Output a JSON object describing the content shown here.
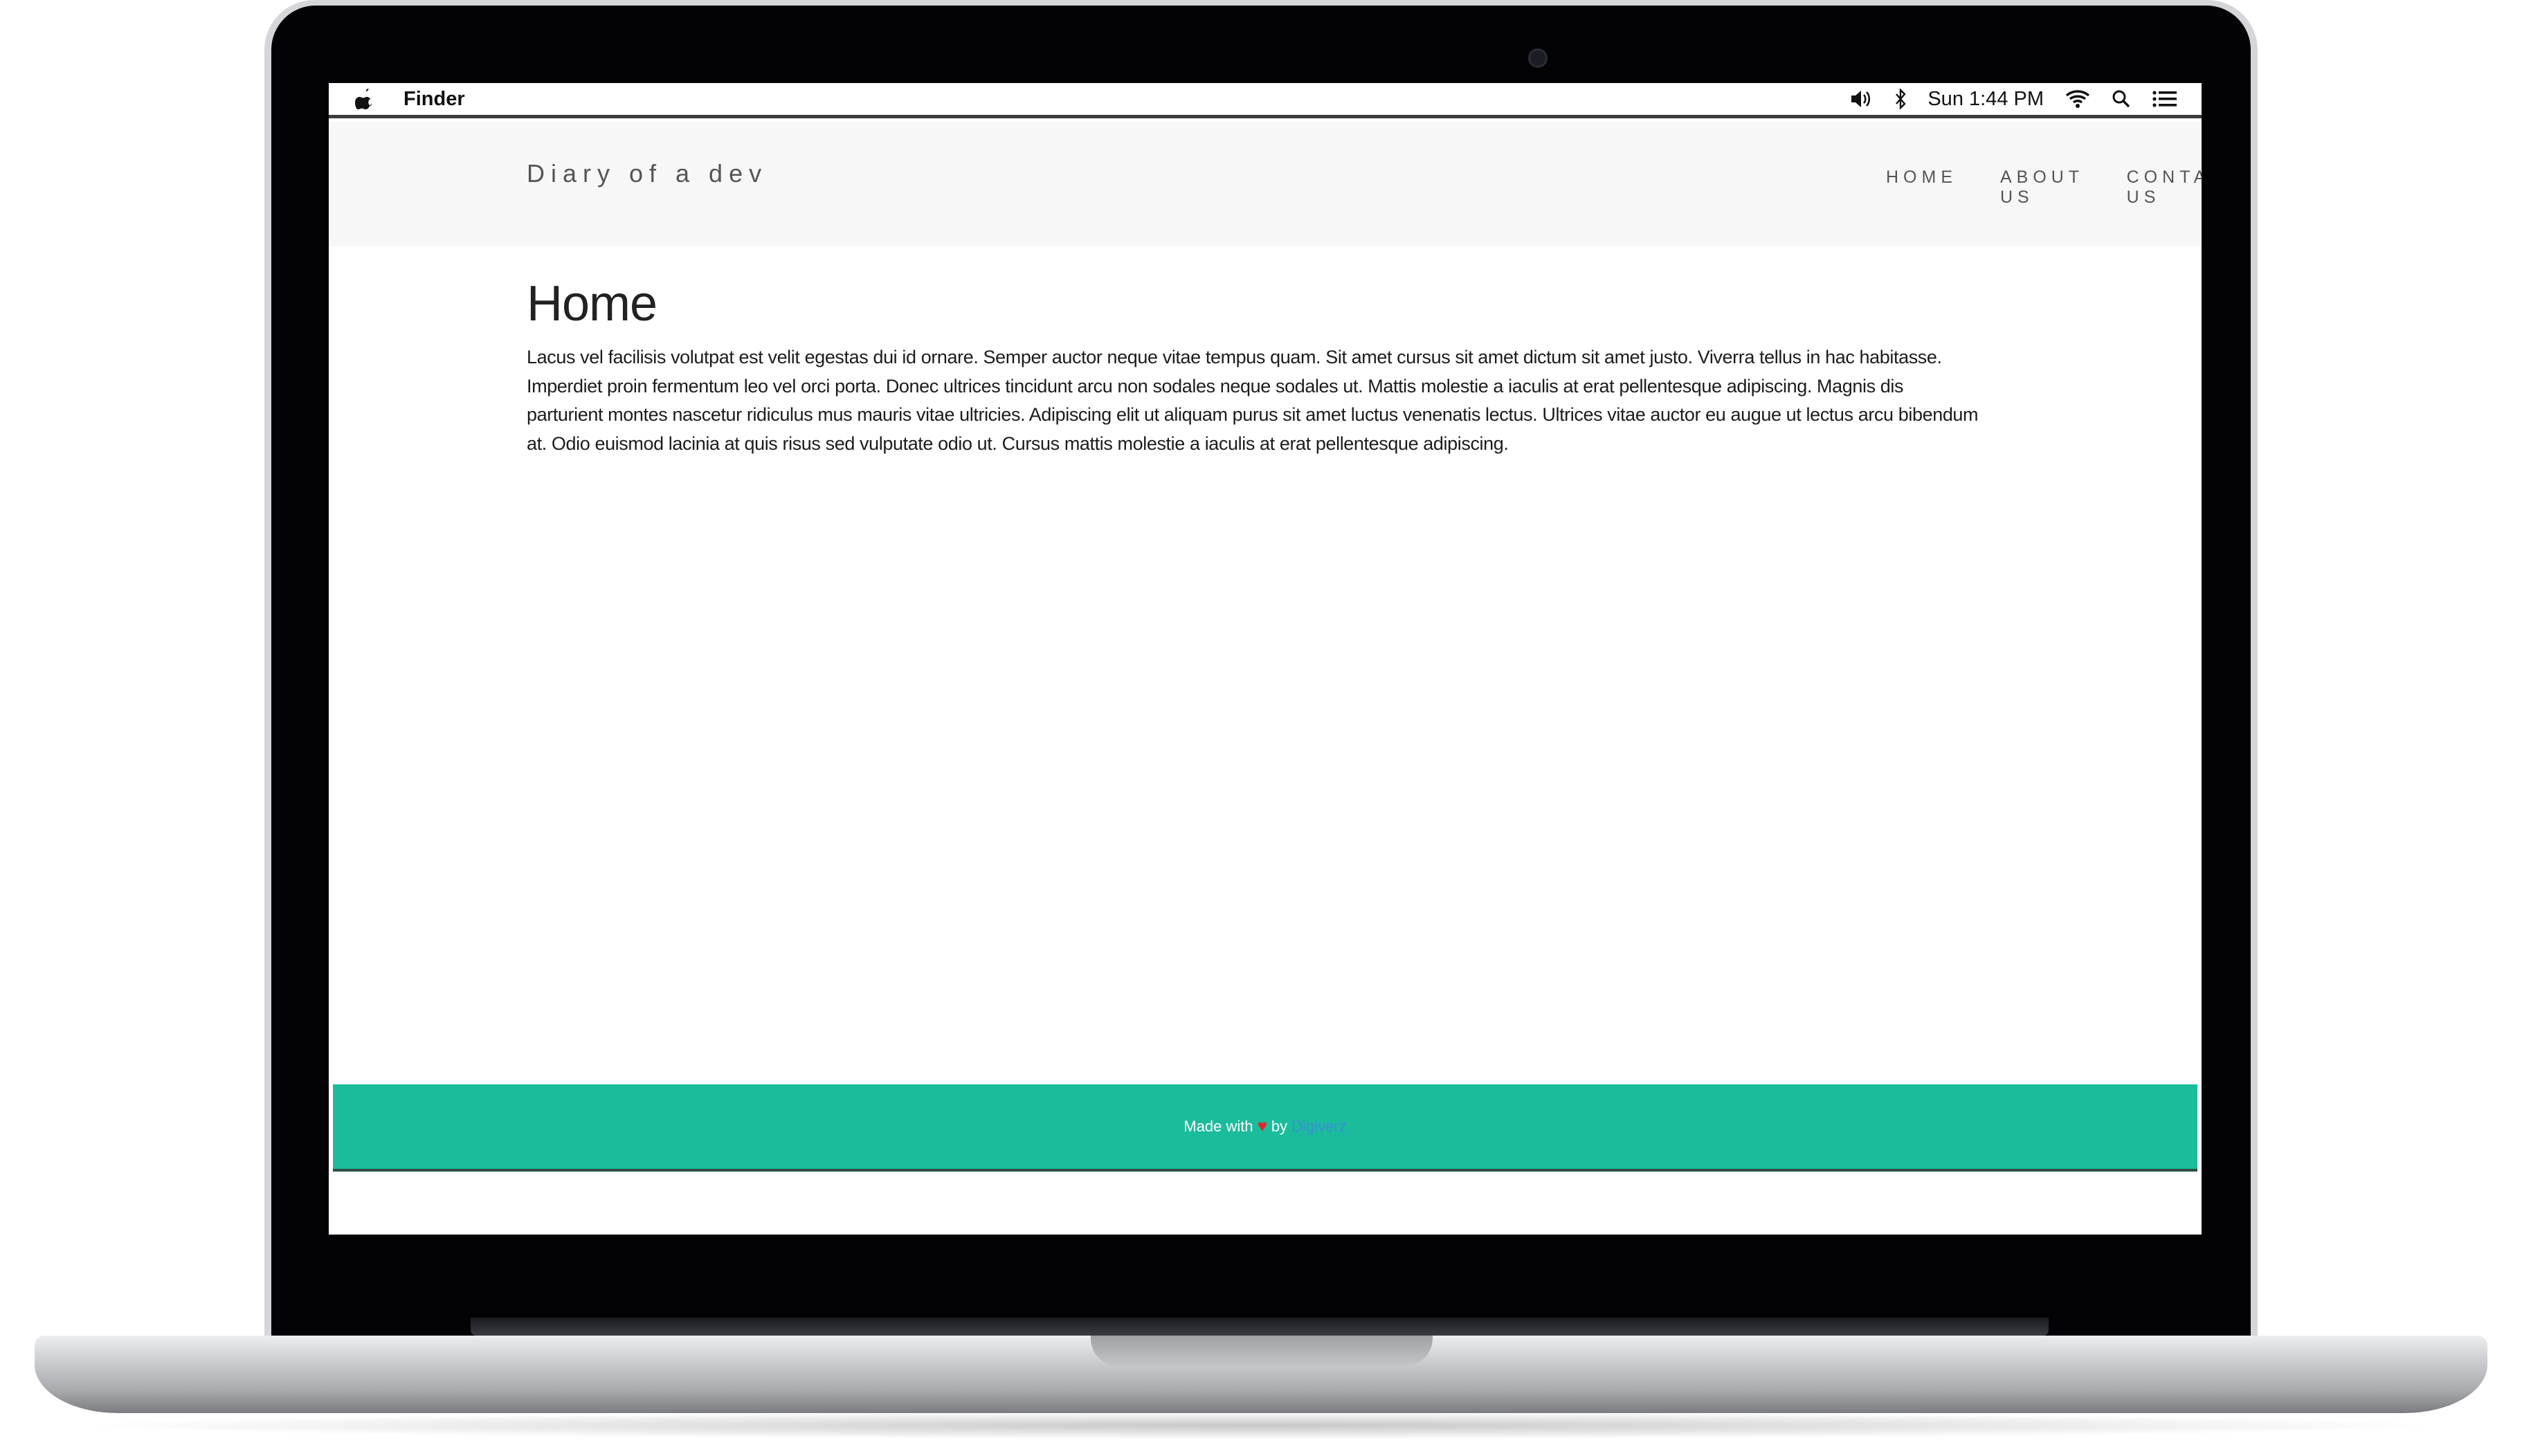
{
  "menubar": {
    "app_name": "Finder",
    "clock": "Sun 1:44 PM",
    "icons": [
      "apple-icon",
      "volume-icon",
      "bluetooth-icon",
      "wifi-icon",
      "spotlight-search-icon",
      "notification-center-icon"
    ]
  },
  "site": {
    "brand": "Diary of a dev",
    "nav": [
      "HOME",
      "ABOUT US",
      "CONTACT US"
    ]
  },
  "page": {
    "title": "Home",
    "body": "Lacus vel facilisis volutpat est velit egestas dui id ornare. Semper auctor neque vitae tempus quam. Sit amet cursus sit amet dictum sit amet justo. Viverra tellus in hac habitasse. Imperdiet proin fermentum leo vel orci porta. Donec ultrices tincidunt arcu non sodales neque sodales ut. Mattis molestie a iaculis at erat pellentesque adipiscing. Magnis dis parturient montes nascetur ridiculus mus mauris vitae ultricies. Adipiscing elit ut aliquam purus sit amet luctus venenatis lectus. Ultrices vitae auctor eu augue ut lectus arcu bibendum at. Odio euismod lacinia at quis risus sed vulputate odio ut. Cursus mattis molestie a iaculis at erat pellentesque adipiscing."
  },
  "footer": {
    "prefix": "Made with",
    "heart": "♥",
    "by": "by",
    "link": "Digiverz"
  },
  "colors": {
    "footer_bg": "#1abc9c",
    "header_bg": "#f7f7f7",
    "heart": "#e8232a",
    "link": "#3b8fd6"
  }
}
